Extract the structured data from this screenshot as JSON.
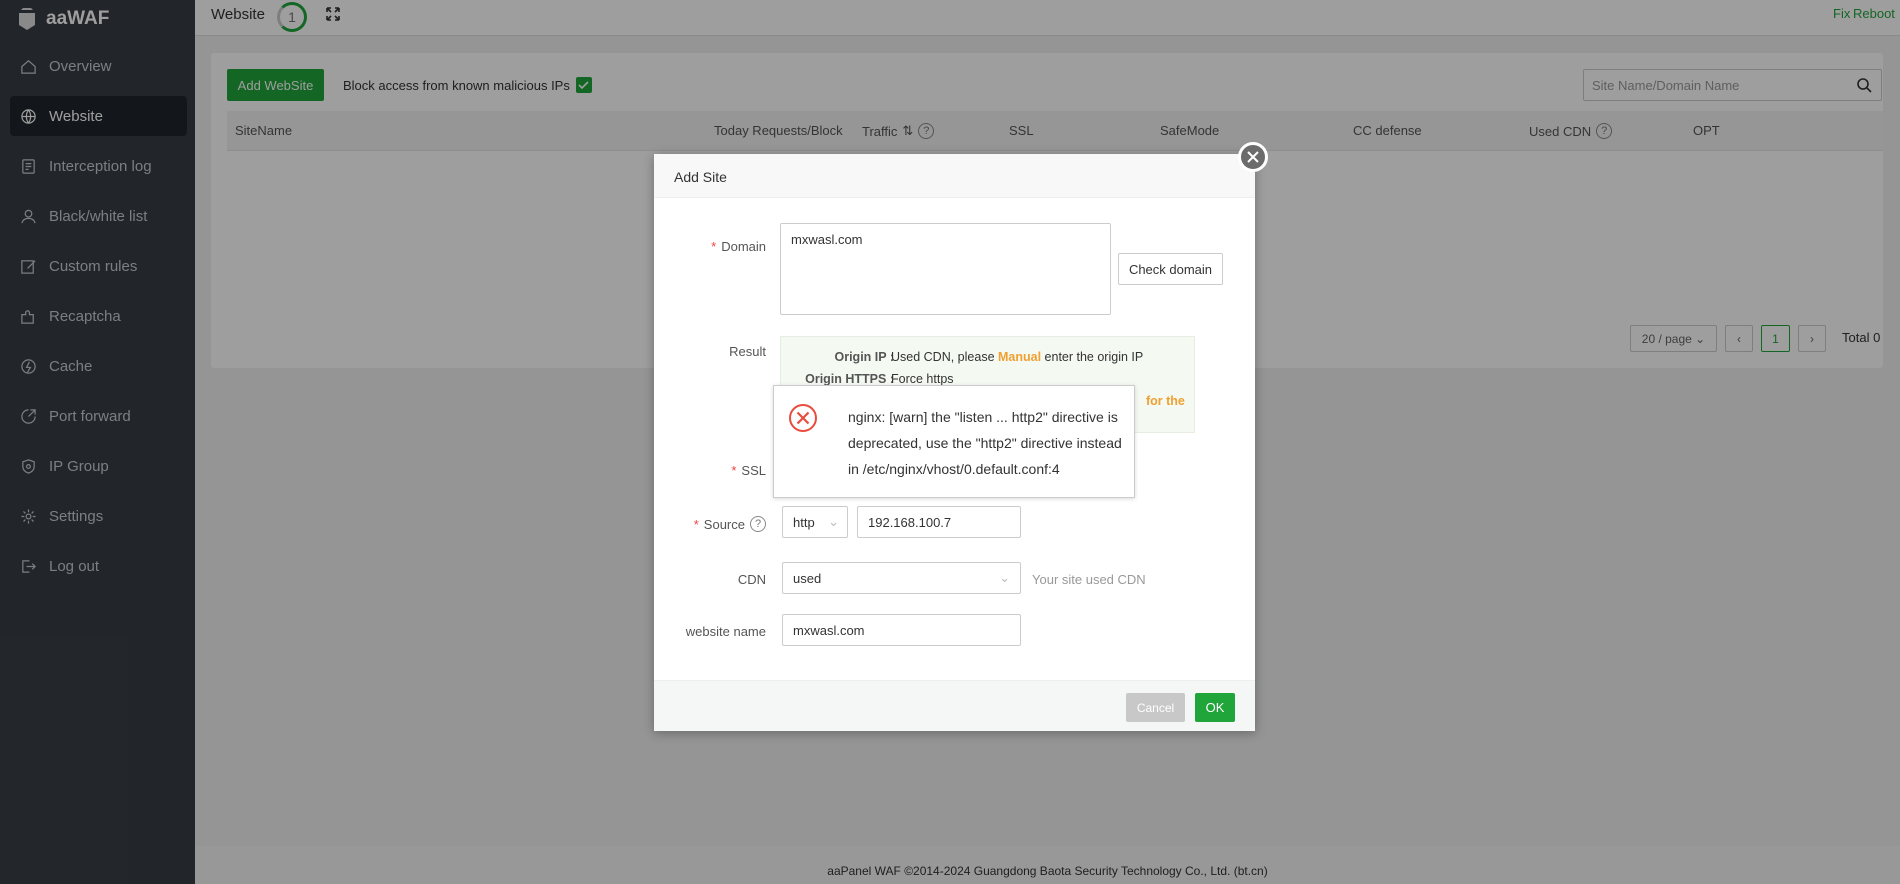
{
  "app": {
    "name": "aaWAF"
  },
  "sidebar": {
    "items": [
      {
        "label": "Overview",
        "icon": "home-icon"
      },
      {
        "label": "Website",
        "icon": "globe-icon",
        "active": true
      },
      {
        "label": "Interception log",
        "icon": "log-icon"
      },
      {
        "label": "Black/white list",
        "icon": "user-icon"
      },
      {
        "label": "Custom rules",
        "icon": "edit-icon"
      },
      {
        "label": "Recaptcha",
        "icon": "puzzle-icon"
      },
      {
        "label": "Cache",
        "icon": "bolt-icon"
      },
      {
        "label": "Port forward",
        "icon": "forward-icon"
      },
      {
        "label": "IP Group",
        "icon": "shield-icon"
      },
      {
        "label": "Settings",
        "icon": "gear-icon"
      },
      {
        "label": "Log out",
        "icon": "logout-icon"
      }
    ]
  },
  "topbar": {
    "title": "Website",
    "badge": "1",
    "fix": "Fix",
    "reboot": "Reboot"
  },
  "toolbar": {
    "add_label": "Add WebSite",
    "block_label": "Block access from known malicious IPs",
    "block_checked": true,
    "search_placeholder": "Site Name/Domain Name"
  },
  "table": {
    "columns": [
      "SiteName",
      "Today Requests/Block",
      "Traffic",
      "SSL",
      "SafeMode",
      "CC defense",
      "Used CDN",
      "OPT"
    ]
  },
  "pagination": {
    "per_page": "20 / page",
    "page": "1",
    "total": "Total 0"
  },
  "footer": {
    "text": "aaPanel WAF ©2014-2024 Guangdong Baota Security Technology Co., Ltd. (bt.cn)"
  },
  "modal": {
    "title": "Add Site",
    "domain_label": "Domain",
    "domain_value": "mxwasl.com",
    "check_label": "Check domain",
    "result_label": "Result",
    "result": {
      "ip_key": "Origin IP :",
      "ip_pre": "Used CDN, please ",
      "ip_link": "Manual",
      "ip_post": " enter the origin IP",
      "https_key": "Origin HTTPS :",
      "https_val": "Force https",
      "hidden_tail": "for the"
    },
    "ssl_label": "SSL",
    "source_label": "Source",
    "source_protocol": "http",
    "source_ip": "192.168.100.7",
    "cdn_label": "CDN",
    "cdn_value": "used",
    "cdn_hint": "Your site used CDN",
    "name_label": "website name",
    "name_value": "mxwasl.com",
    "cancel_label": "Cancel",
    "ok_label": "OK"
  },
  "toast": {
    "type": "error",
    "message": "nginx: [warn] the \"listen ... http2\" directive is deprecated, use the \"http2\" directive instead in /etc/nginx/vhost/0.default.conf:4"
  },
  "colors": {
    "accent": "#20a53a",
    "warning": "#f0a030",
    "error": "#e84c3d"
  }
}
